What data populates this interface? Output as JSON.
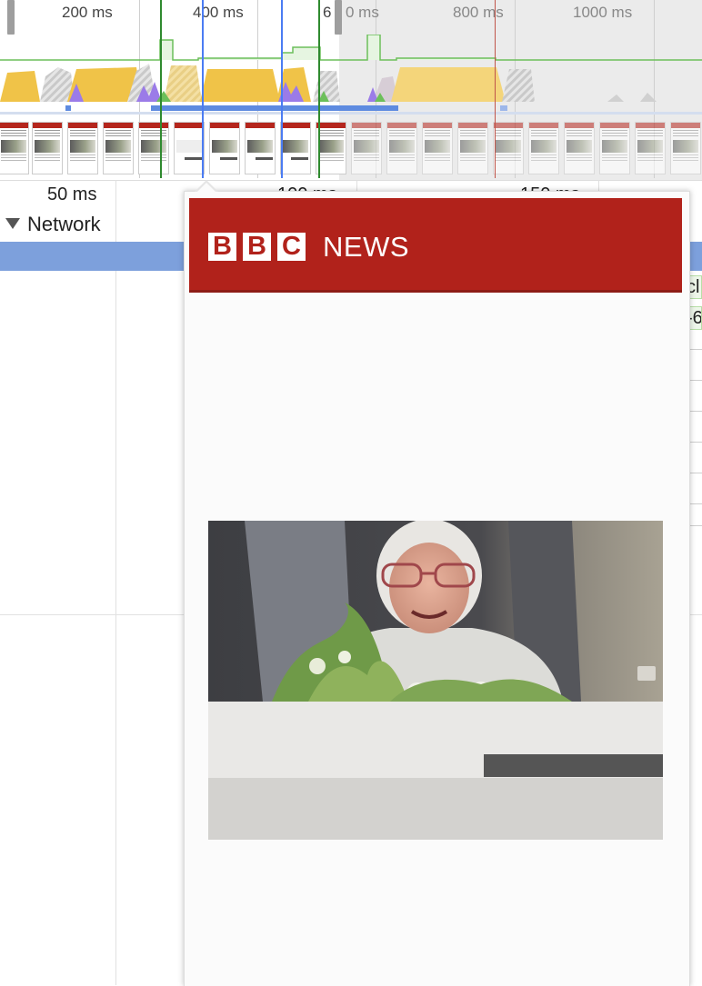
{
  "overview": {
    "tick_labels": [
      "200 ms",
      "400 ms",
      "6",
      "0 ms",
      "800 ms",
      "1000 ms"
    ],
    "colors": {
      "scripting": "#f0c348",
      "rendering": "#9b7be8",
      "painting": "#6cbf5a",
      "idle_stripe": "#cfcfcf",
      "selection_marker": "#4b7cf3",
      "green_marker": "#2f8a2f",
      "red_marker": "#c0554a",
      "network_bar": "#7da0dc"
    }
  },
  "ruler": {
    "labels": [
      "50 ms",
      "100 ms",
      "150 ms"
    ]
  },
  "network": {
    "label": "Network",
    "toggle_state": "expanded",
    "request_fragments": [
      "cl",
      "-6"
    ]
  },
  "screenshot_popover": {
    "brand_letters": [
      "B",
      "B",
      "C"
    ],
    "brand_word": "NEWS",
    "header_color": "#b1221b",
    "photo_subject": "elderly woman with glasses holding flowers"
  }
}
